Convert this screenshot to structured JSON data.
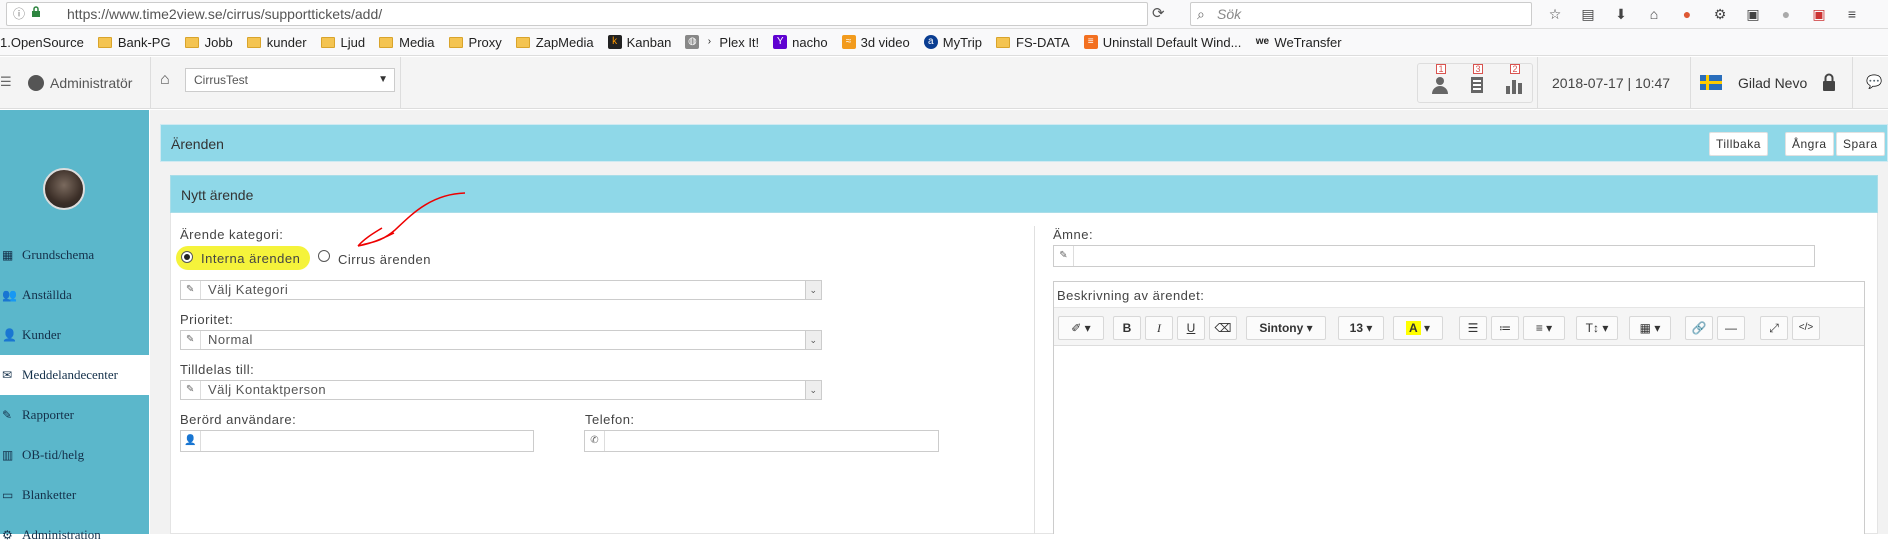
{
  "browser": {
    "url": "https://www.time2view.se/cirrus/supporttickets/add/",
    "search_placeholder": "Sök",
    "bookmarks": [
      "1.OpenSource",
      "Bank-PG",
      "Jobb",
      "kunder",
      "Ljud",
      "Media",
      "Proxy",
      "ZapMedia",
      "Kanban",
      "Plex It!",
      "nacho",
      "3d video",
      "MyTrip",
      "FS-DATA",
      "Uninstall Default Wind...",
      "WeTransfer"
    ]
  },
  "header": {
    "admin_label": "Administratör",
    "site_select": "CirrusTest",
    "badges": [
      "1",
      "3",
      "2"
    ],
    "datetime": "2018-07-17 | 10:47",
    "user_name": "Gilad Nevo"
  },
  "sidebar": {
    "items": [
      {
        "label": "Grundschema",
        "icon": "calendar-icon"
      },
      {
        "label": "Anställda",
        "icon": "users-icon"
      },
      {
        "label": "Kunder",
        "icon": "user-icon"
      },
      {
        "label": "Meddelandecenter",
        "icon": "envelope-icon"
      },
      {
        "label": "Rapporter",
        "icon": "pencil-icon"
      },
      {
        "label": "OB-tid/helg",
        "icon": "chart-icon"
      },
      {
        "label": "Blanketter",
        "icon": "folder-icon"
      },
      {
        "label": "Administration",
        "icon": "gear-icon"
      }
    ]
  },
  "panel": {
    "title": "Ärenden",
    "buttons": {
      "back": "Tillbaka",
      "undo": "Ångra",
      "save": "Spara"
    }
  },
  "form": {
    "title": "Nytt ärende",
    "category_label": "Ärende kategori:",
    "radio_internal": "Interna ärenden",
    "radio_cirrus": "Cirrus ärenden",
    "category_select": "Välj Kategori",
    "priority_label": "Prioritet:",
    "priority_select": "Normal",
    "assign_label": "Tilldelas till:",
    "assign_select": "Välj Kontaktperson",
    "affected_label": "Berörd användare:",
    "phone_label": "Telefon:",
    "subject_label": "Ämne:",
    "description_label": "Beskrivning av ärendet:",
    "editor": {
      "font": "Sintony",
      "size": "13"
    }
  }
}
